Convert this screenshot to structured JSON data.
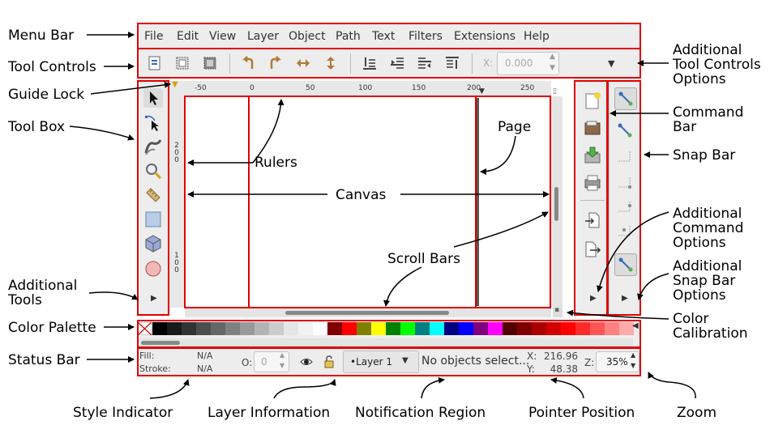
{
  "menu": [
    "File",
    "Edit",
    "View",
    "Layer",
    "Object",
    "Path",
    "Text",
    "Filters",
    "Extensions",
    "Help"
  ],
  "toolbar": {
    "x_label": "X:",
    "x_value": "0.000"
  },
  "ruler": {
    "h_ticks": [
      "-50",
      "0",
      "50",
      "100",
      "150",
      "200",
      "250"
    ],
    "v_ticks_1": [
      "2",
      "0",
      "0"
    ],
    "v_ticks_2": [
      "1",
      "0",
      "0"
    ]
  },
  "status": {
    "fill_label": "Fill:",
    "fill_value": "N/A",
    "stroke_label": "Stroke:",
    "stroke_value": "N/A",
    "opacity_label": "O:",
    "opacity_value": "0",
    "layer": "•Layer 1",
    "notification": "No objects select...",
    "x_label": "X:",
    "x_value": "216.96",
    "y_label": "Y:",
    "y_value": "48.38",
    "zoom_label": "Z:",
    "zoom_value": "35%"
  },
  "palette_colors": [
    "#000000",
    "#1a1a1a",
    "#333333",
    "#4d4d4d",
    "#666666",
    "#808080",
    "#999999",
    "#b3b3b3",
    "#cccccc",
    "#e6e6e6",
    "#f2f2f2",
    "#ffffff",
    "#800000",
    "#ff0000",
    "#808000",
    "#ffff00",
    "#008000",
    "#00ff00",
    "#008080",
    "#00ffff",
    "#000080",
    "#0000ff",
    "#800080",
    "#ff00ff",
    "#550000",
    "#800000",
    "#aa0000",
    "#d40000",
    "#ff0000",
    "#ff2a2a",
    "#ff5555",
    "#ff8080",
    "#ffaaaa"
  ],
  "annotations": {
    "menu_bar": "Menu Bar",
    "tool_controls": "Tool Controls",
    "guide_lock": "Guide Lock",
    "tool_box": "Tool Box",
    "additional_tools": [
      "Additional",
      "Tools"
    ],
    "color_palette": "Color Palette",
    "status_bar": "Status Bar",
    "additional_tool_controls": [
      "Additional",
      "Tool Controls",
      "Options"
    ],
    "command_bar": [
      "Command",
      "Bar"
    ],
    "snap_bar": "Snap Bar",
    "additional_command": [
      "Additional",
      "Command",
      "Options"
    ],
    "additional_snap": [
      "Additional",
      "Snap Bar",
      "Options"
    ],
    "color_calibration": [
      "Color",
      "Calibration"
    ],
    "rulers": "Rulers",
    "page": "Page",
    "canvas": "Canvas",
    "scroll_bars": "Scroll Bars",
    "style_indicator": "Style Indicator",
    "layer_information": "Layer Information",
    "notification_region": "Notification Region",
    "pointer_position": "Pointer Position",
    "zoom": "Zoom"
  }
}
